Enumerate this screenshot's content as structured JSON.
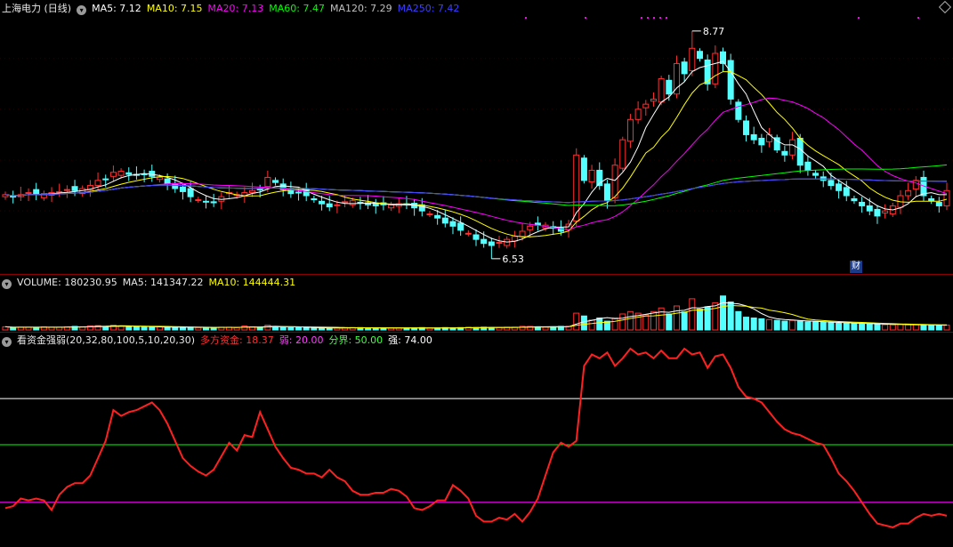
{
  "main": {
    "title": "上海电力 (日线)",
    "ma": [
      {
        "label": "MA5: 7.12",
        "color": "#ffffff"
      },
      {
        "label": "MA10: 7.15",
        "color": "#ffff00"
      },
      {
        "label": "MA20: 7.13",
        "color": "#ff00ff"
      },
      {
        "label": "MA60: 7.47",
        "color": "#00ff00"
      },
      {
        "label": "MA120: 7.29",
        "color": "#c0c0c0"
      },
      {
        "label": "MA250: 7.42",
        "color": "#3f3fff"
      }
    ],
    "high_label": "8.77",
    "low_label": "6.53",
    "badge": "财"
  },
  "volume": {
    "vol": "VOLUME: 180230.95",
    "ma5": "MA5: 141347.22",
    "ma10": "MA10: 144444.31"
  },
  "indicator": {
    "name": "看资金强弱(20,32,80,100,5,10,20,30)",
    "items": [
      {
        "label": "多方资金: 18.37",
        "color": "#ff3030"
      },
      {
        "label": "弱: 20.00",
        "color": "#ff40ff"
      },
      {
        "label": "分界: 50.00",
        "color": "#40ff40"
      },
      {
        "label": "强: 74.00",
        "color": "#ffffff"
      }
    ]
  },
  "chart_data": [
    {
      "type": "candlestick",
      "title": "上海电力 (日线)",
      "high_annotation": 8.77,
      "low_annotation": 6.53,
      "ylim": [
        6.45,
        8.9
      ],
      "up_color": "#ff3030",
      "down_color": "#54ffff",
      "close": [
        7.16,
        7.14,
        7.16,
        7.18,
        7.16,
        7.17,
        7.18,
        7.19,
        7.21,
        7.2,
        7.22,
        7.25,
        7.3,
        7.31,
        7.38,
        7.39,
        7.36,
        7.35,
        7.36,
        7.34,
        7.33,
        7.27,
        7.22,
        7.19,
        7.14,
        7.11,
        7.09,
        7.08,
        7.14,
        7.18,
        7.16,
        7.18,
        7.2,
        7.21,
        7.33,
        7.28,
        7.21,
        7.17,
        7.18,
        7.15,
        7.11,
        7.07,
        7.04,
        7.06,
        7.09,
        7.1,
        7.08,
        7.06,
        7.05,
        7.06,
        7.06,
        7.07,
        7.06,
        7.03,
        7.0,
        6.97,
        6.93,
        6.88,
        6.85,
        6.81,
        6.78,
        6.72,
        6.68,
        6.66,
        6.69,
        6.72,
        6.75,
        6.8,
        6.85,
        6.86,
        6.86,
        6.83,
        6.8,
        6.87,
        7.55,
        7.3,
        7.4,
        7.25,
        7.1,
        7.45,
        7.7,
        7.9,
        8.0,
        8.05,
        8.1,
        8.3,
        8.15,
        8.45,
        8.35,
        8.6,
        8.5,
        8.25,
        8.55,
        8.45,
        8.1,
        7.9,
        7.75,
        7.7,
        7.65,
        7.75,
        7.6,
        7.55,
        7.7,
        7.45,
        7.4,
        7.35,
        7.3,
        7.25,
        7.2,
        7.15,
        7.1,
        7.05,
        7.0,
        6.95,
        7.0,
        7.05,
        7.15,
        7.2,
        7.3,
        7.15,
        7.1,
        7.05,
        7.2
      ],
      "volume_max": 1.0,
      "volume": [
        0.08,
        0.06,
        0.07,
        0.07,
        0.06,
        0.08,
        0.07,
        0.07,
        0.08,
        0.09,
        0.08,
        0.1,
        0.11,
        0.09,
        0.12,
        0.1,
        0.09,
        0.08,
        0.07,
        0.07,
        0.08,
        0.07,
        0.07,
        0.06,
        0.07,
        0.06,
        0.06,
        0.06,
        0.07,
        0.07,
        0.06,
        0.1,
        0.08,
        0.07,
        0.12,
        0.09,
        0.07,
        0.06,
        0.06,
        0.06,
        0.05,
        0.05,
        0.05,
        0.05,
        0.06,
        0.06,
        0.06,
        0.05,
        0.05,
        0.05,
        0.05,
        0.05,
        0.05,
        0.05,
        0.06,
        0.05,
        0.05,
        0.06,
        0.05,
        0.06,
        0.07,
        0.06,
        0.07,
        0.06,
        0.06,
        0.07,
        0.07,
        0.09,
        0.09,
        0.08,
        0.07,
        0.08,
        0.09,
        0.09,
        0.42,
        0.35,
        0.25,
        0.3,
        0.22,
        0.3,
        0.4,
        0.46,
        0.42,
        0.38,
        0.46,
        0.55,
        0.4,
        0.6,
        0.45,
        0.78,
        0.52,
        0.58,
        0.68,
        0.85,
        0.7,
        0.46,
        0.32,
        0.3,
        0.28,
        0.26,
        0.24,
        0.22,
        0.24,
        0.22,
        0.2,
        0.2,
        0.19,
        0.18,
        0.17,
        0.17,
        0.16,
        0.15,
        0.15,
        0.14,
        0.13,
        0.13,
        0.14,
        0.13,
        0.13,
        0.12,
        0.12,
        0.11,
        0.12
      ]
    },
    {
      "type": "line",
      "title": "看资金强弱(20,32,80,100,5,10,20,30)",
      "series_name": "多方资金",
      "levels": {
        "弱": 20,
        "分界": 50,
        "强": 74
      },
      "ylim": [
        0,
        100
      ],
      "values": [
        17,
        18,
        22,
        21,
        22,
        21,
        16,
        24,
        28,
        30,
        30,
        34,
        43,
        52,
        68,
        65,
        67,
        68,
        70,
        72,
        68,
        61,
        52,
        43,
        39,
        36,
        34,
        37,
        44,
        51,
        47,
        55,
        54,
        67,
        58,
        49,
        43,
        38,
        37,
        35,
        35,
        33,
        37,
        33,
        31,
        26,
        24,
        24,
        25,
        25,
        27,
        26,
        23,
        17,
        16,
        18,
        21,
        21,
        29,
        26,
        22,
        13,
        10,
        10,
        12,
        11,
        14,
        10,
        15,
        22,
        34,
        46,
        51,
        49,
        52,
        91,
        97,
        95,
        98,
        91,
        95,
        100,
        97,
        98,
        95,
        99,
        95,
        95,
        100,
        97,
        98,
        90,
        96,
        97,
        90,
        80,
        75,
        74,
        72,
        67,
        62,
        58,
        56,
        55,
        53,
        51,
        50,
        43,
        35,
        31,
        26,
        20,
        14,
        9,
        8,
        7,
        9,
        9,
        12,
        14,
        13,
        14,
        13
      ]
    }
  ]
}
